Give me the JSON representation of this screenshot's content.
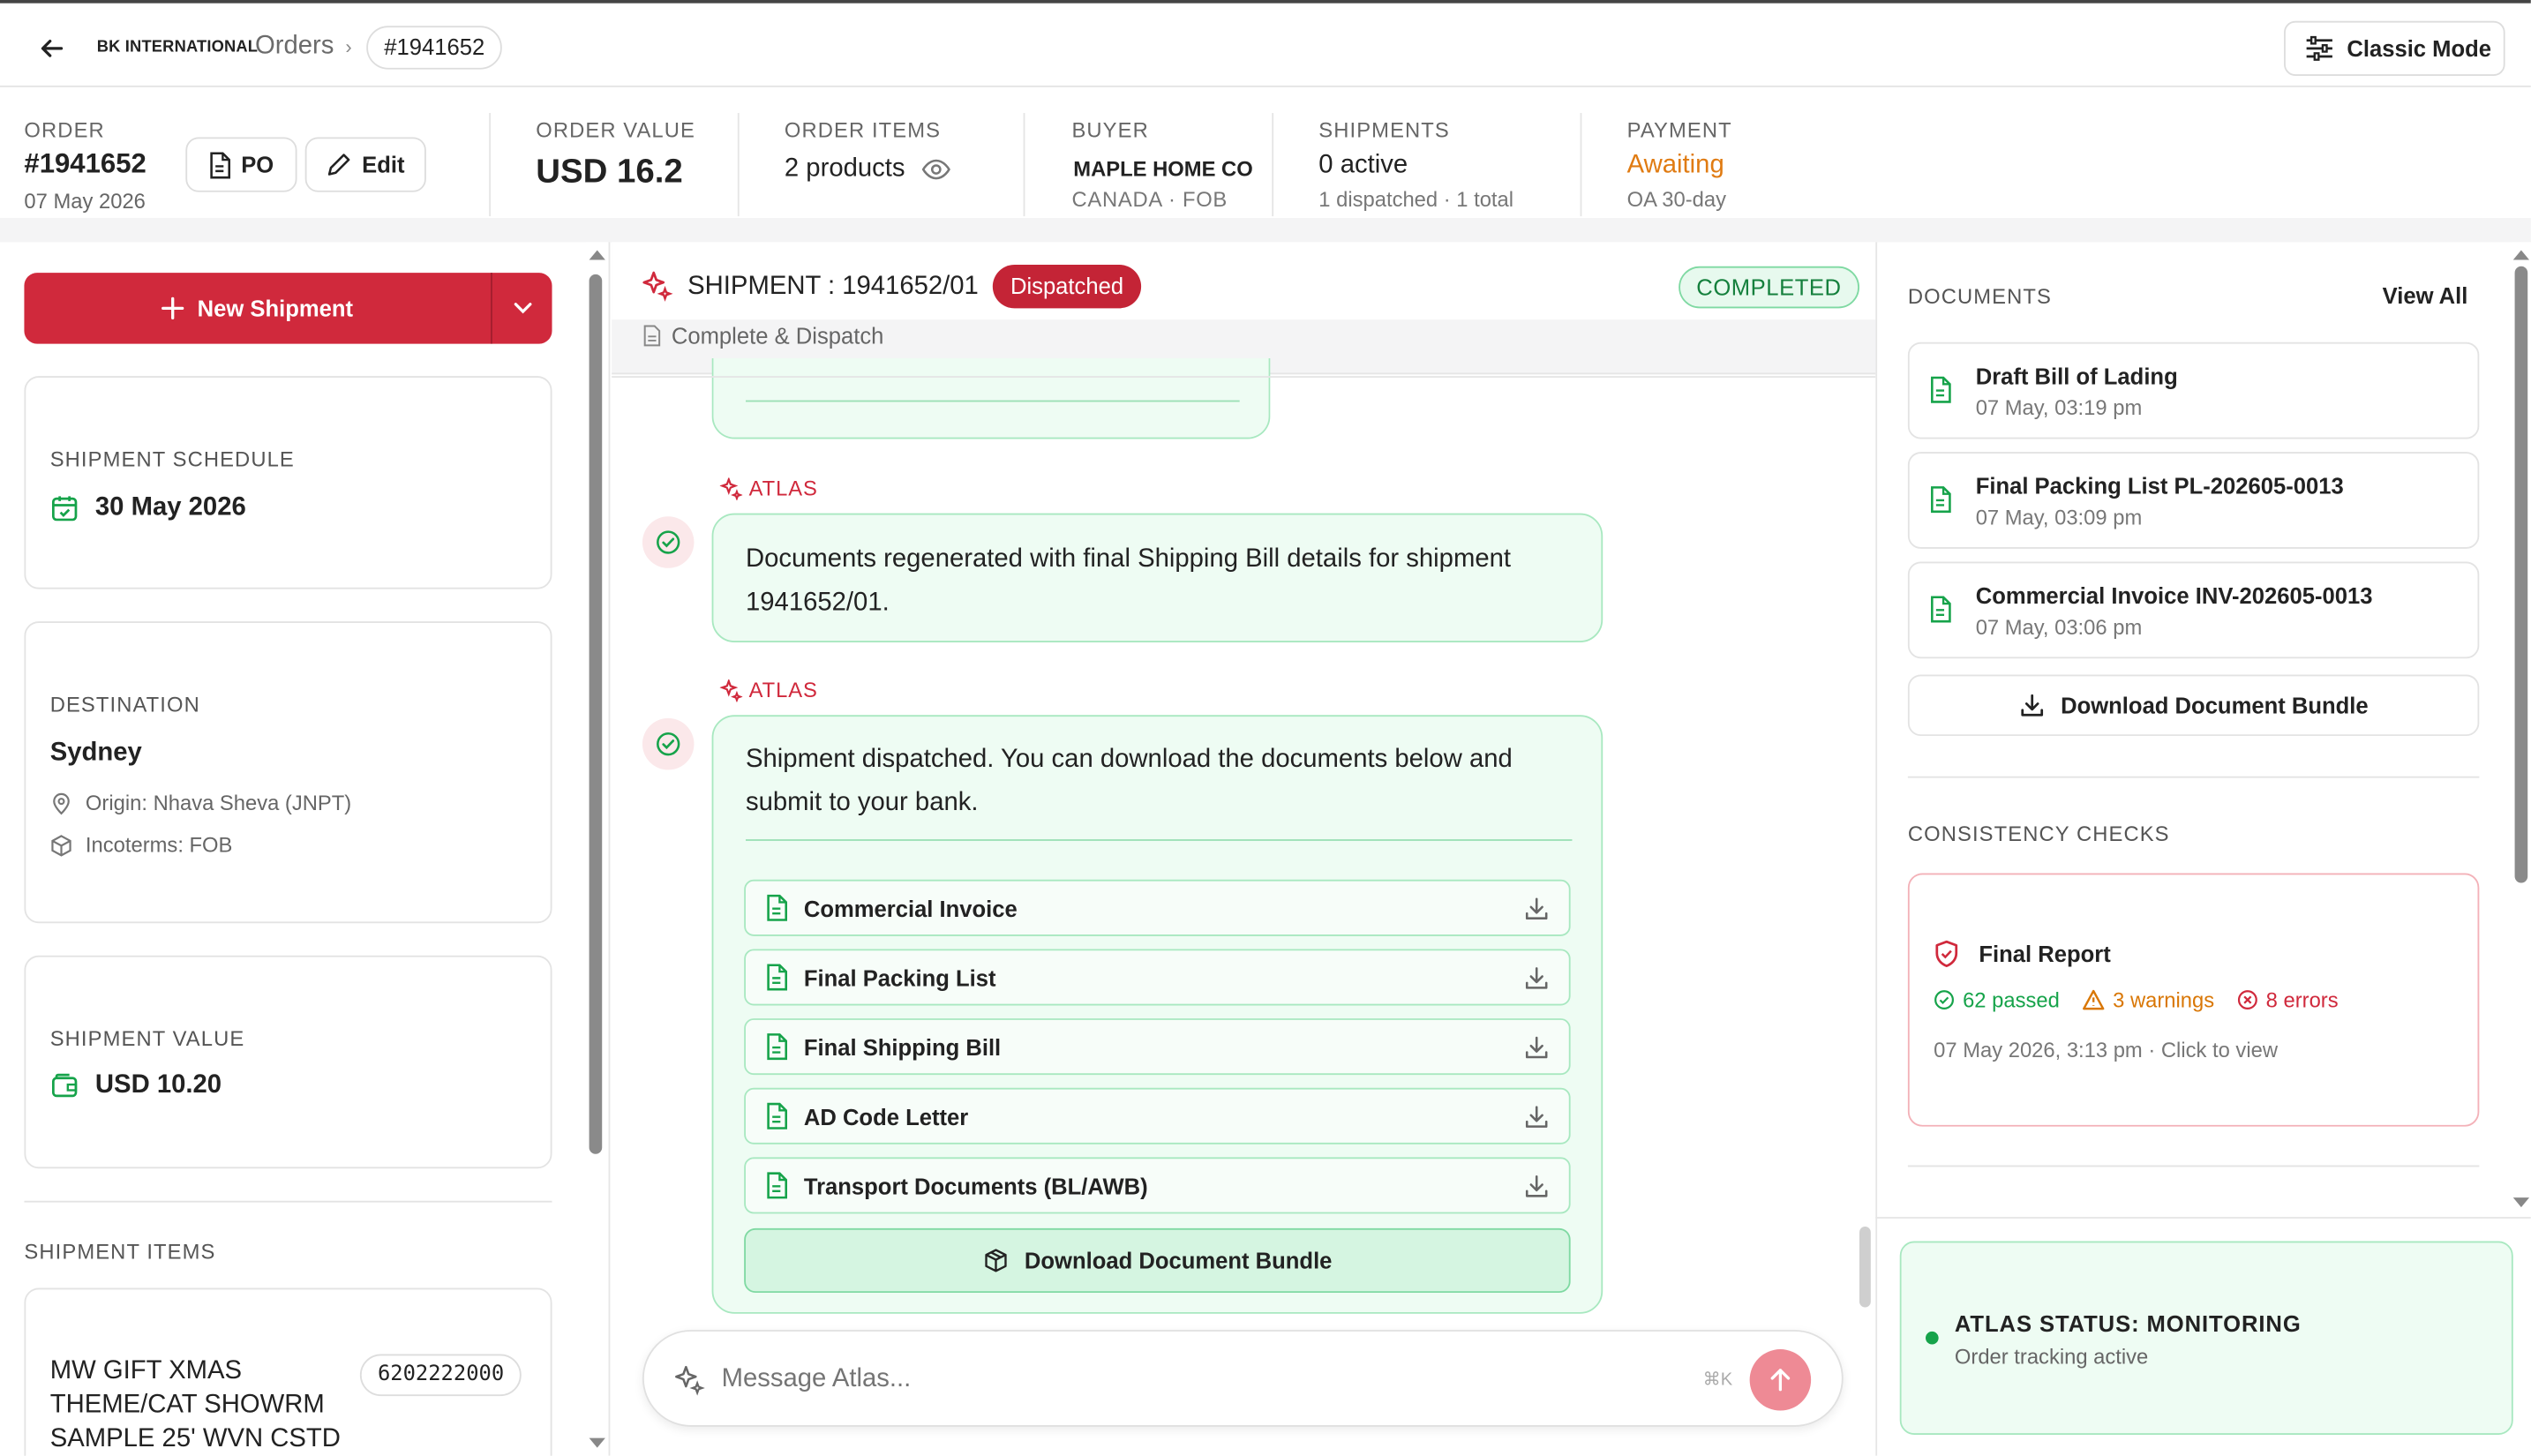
{
  "header": {
    "brand": "BK INTERNATIONAL",
    "breadcrumb_orders": "Orders",
    "breadcrumb_sep": "›",
    "order_pill": "#1941652",
    "classic_mode_label": "Classic Mode"
  },
  "summary": {
    "order_label": "ORDER",
    "order_number": "#1941652",
    "order_date": "07 May 2026",
    "po_label": "PO",
    "edit_label": "Edit",
    "order_value_label": "ORDER VALUE",
    "order_value": "USD 16.2",
    "order_items_label": "ORDER ITEMS",
    "order_items": "2 products",
    "buyer_label": "BUYER",
    "buyer_name": "MAPLE HOME CO",
    "buyer_sub": "CANADA · FOB",
    "shipments_label": "SHIPMENTS",
    "shipments_active": "0 active",
    "shipments_sub": "1 dispatched · 1 total",
    "payment_label": "PAYMENT",
    "payment_status": "Awaiting",
    "payment_terms": "OA 30-day"
  },
  "left": {
    "new_shipment_label": "New Shipment",
    "schedule_title": "SHIPMENT SCHEDULE",
    "schedule_date": "30 May 2026",
    "destination_title": "DESTINATION",
    "destination_city": "Sydney",
    "origin": "Origin: Nhava Sheva (JNPT)",
    "incoterms": "Incoterms: FOB",
    "value_title": "SHIPMENT VALUE",
    "value_amount": "USD 10.20",
    "items_title": "SHIPMENT ITEMS",
    "item_name": "MW GIFT XMAS THEME/CAT SHOWRM SAMPLE 25' WVN CSTD",
    "item_code": "6202222000"
  },
  "center": {
    "shipment_title": "SHIPMENT : 1941652/01",
    "dispatched_badge": "Dispatched",
    "completed_badge": "COMPLETED",
    "stage_label": "Complete & Dispatch",
    "atlas_label_1": "ATLAS",
    "message_1": "Documents regenerated with final Shipping Bill details for shipment 1941652/01.",
    "atlas_label_2": "ATLAS",
    "message_2": "Shipment dispatched. You can download the documents below and submit to your bank.",
    "documents": [
      {
        "name": "Commercial Invoice"
      },
      {
        "name": "Final Packing List"
      },
      {
        "name": "Final Shipping Bill"
      },
      {
        "name": "AD Code Letter"
      },
      {
        "name": "Transport Documents (BL/AWB)"
      }
    ],
    "bundle_label": "Download Document Bundle",
    "input_placeholder": "Message Atlas...",
    "shortcut": "⌘K"
  },
  "right": {
    "documents_title": "DOCUMENTS",
    "view_all": "View All",
    "docs": [
      {
        "name": "Draft Bill of Lading",
        "time": "07 May, 03:19 pm"
      },
      {
        "name": "Final Packing List PL-202605-0013",
        "time": "07 May, 03:09 pm"
      },
      {
        "name": "Commercial Invoice INV-202605-0013",
        "time": "07 May, 03:06 pm"
      }
    ],
    "bundle_label": "Download Document Bundle",
    "checks_title": "CONSISTENCY CHECKS",
    "report_title": "Final Report",
    "passed": "62 passed",
    "warnings": "3 warnings",
    "errors": "8 errors",
    "report_time": "07 May 2026, 3:13 pm · Click to view",
    "atlas_status": "ATLAS STATUS: MONITORING",
    "atlas_status_sub": "Order tracking active"
  },
  "colors": {
    "brand_red": "#d0293c",
    "success_green": "#16a34a",
    "warning_orange": "#d97706",
    "payment_orange": "#e07b12"
  }
}
